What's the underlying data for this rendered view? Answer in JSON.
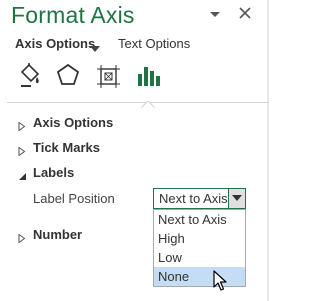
{
  "pane": {
    "title": "Format Axis",
    "accent_color": "#217346"
  },
  "tabs": {
    "axis_options": "Axis Options",
    "text_options": "Text Options"
  },
  "icons": [
    "fill-line-icon",
    "effects-icon",
    "size-properties-icon",
    "axis-options-icon"
  ],
  "sections": {
    "axis_options": "Axis Options",
    "tick_marks": "Tick Marks",
    "labels": "Labels",
    "number": "Number"
  },
  "labels": {
    "label_position_text": "Label Position",
    "label_position_value": "Next to Axis",
    "options": [
      "Next to Axis",
      "High",
      "Low",
      "None"
    ],
    "highlighted_option": "None"
  }
}
